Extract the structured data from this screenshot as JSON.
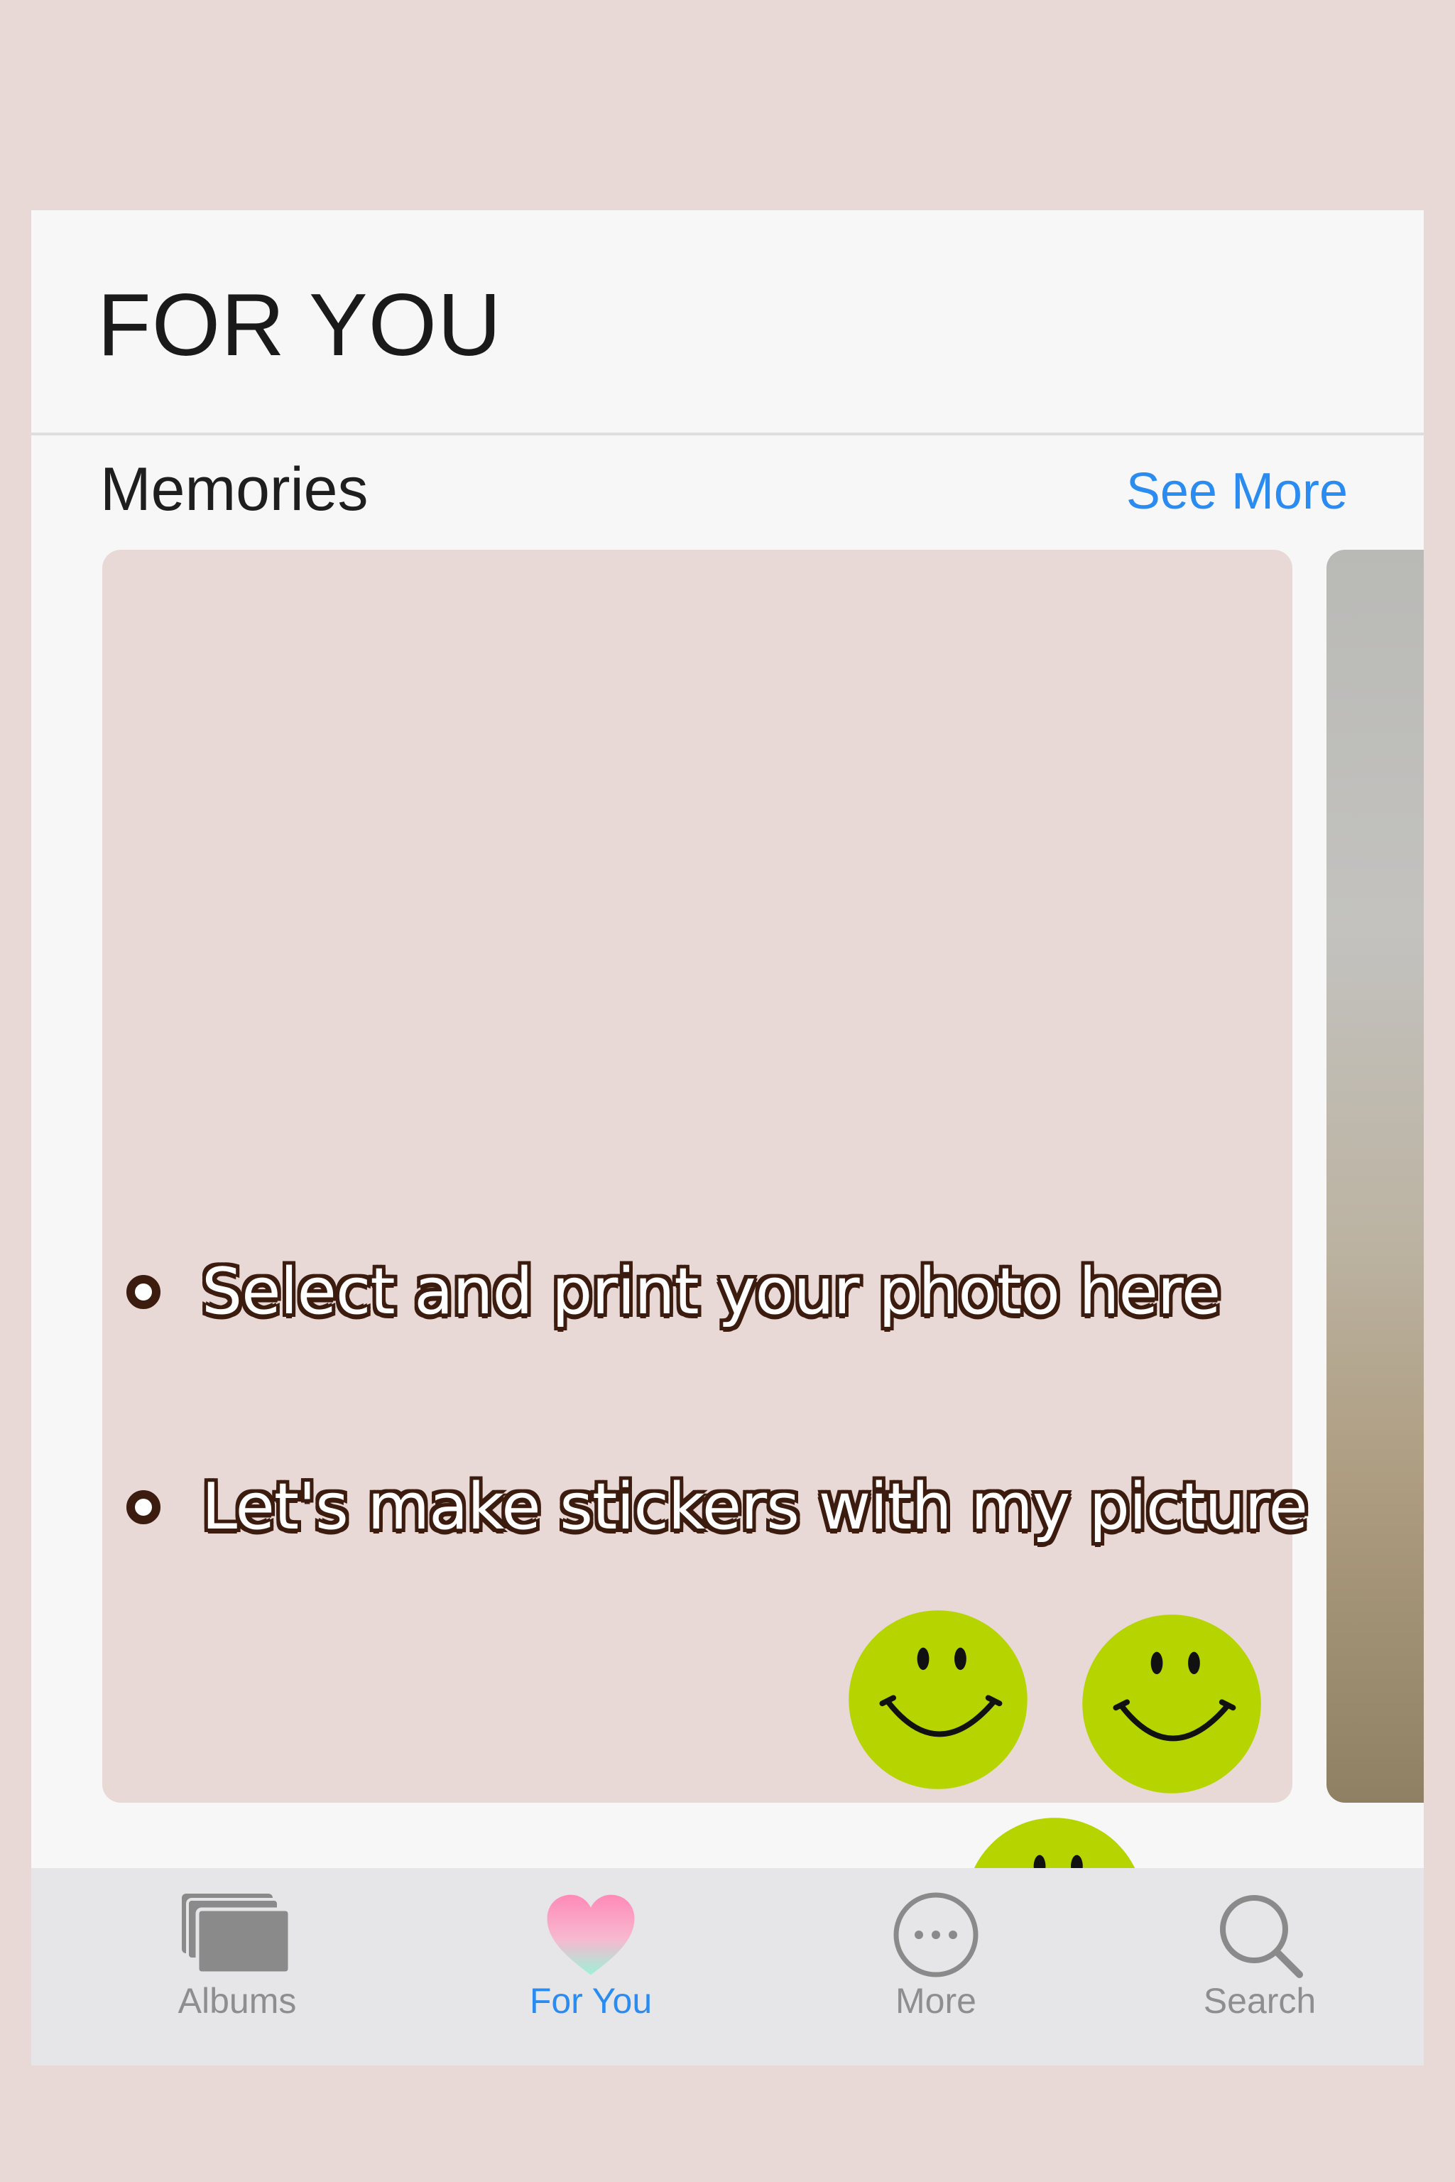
{
  "header": {
    "title": "FOR YOU"
  },
  "memories": {
    "section_title": "Memories",
    "see_more_label": "See More",
    "card": {
      "lines": [
        "Select and print your photo here",
        "Let's make stickers with my picture"
      ],
      "stickers": [
        "smiley-face-icon",
        "smiley-face-icon",
        "smiley-face-icon"
      ],
      "sticker_color": "#b5d400"
    }
  },
  "tabbar": {
    "active_tab": "For You",
    "tabs": [
      {
        "label": "Albums",
        "icon": "albums-icon"
      },
      {
        "label": "For You",
        "icon": "heart-icon"
      },
      {
        "label": "More",
        "icon": "more-icon"
      },
      {
        "label": "Search",
        "icon": "search-icon"
      }
    ],
    "active_color": "#2a8cf0",
    "inactive_color": "#8e8e8e"
  }
}
